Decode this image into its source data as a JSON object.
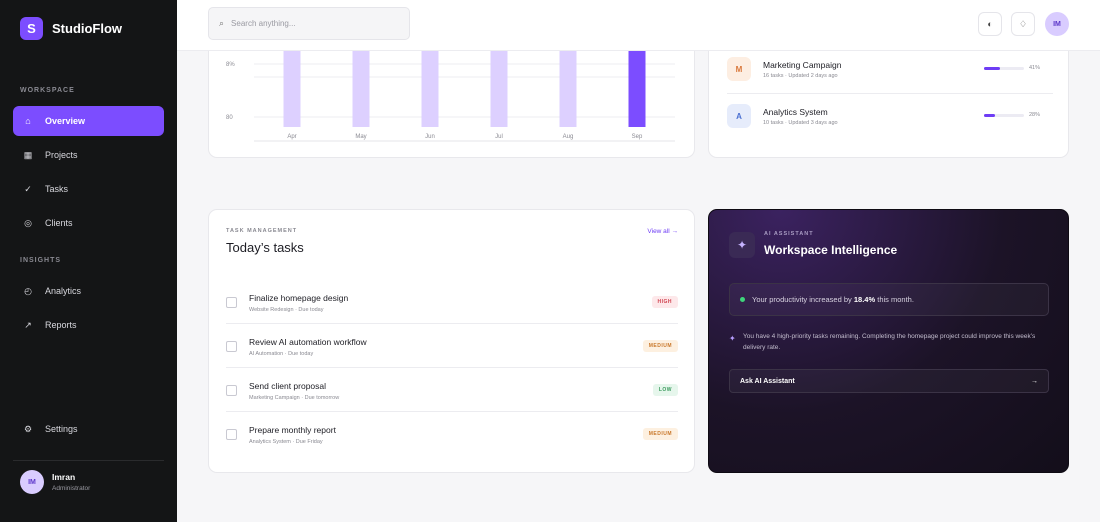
{
  "brand": {
    "logo_letter": "S",
    "name": "StudioFlow",
    "accent": "#7c4dff"
  },
  "sidebar": {
    "workspace_label": "WORKSPACE",
    "insights_label": "INSIGHTS",
    "items": [
      {
        "label": "Overview",
        "icon": "home-icon",
        "active": true
      },
      {
        "label": "Projects",
        "icon": "grid-icon"
      },
      {
        "label": "Tasks",
        "icon": "check-icon"
      },
      {
        "label": "Clients",
        "icon": "users-icon"
      },
      {
        "label": "Analytics",
        "icon": "chart-icon"
      },
      {
        "label": "Reports",
        "icon": "report-icon"
      },
      {
        "label": "Settings",
        "icon": "gear-icon"
      }
    ],
    "user": {
      "initials": "IM",
      "name": "Imran",
      "role": "Administrator"
    }
  },
  "header": {
    "search_placeholder": "Search anything...",
    "avatar_initials": "IM"
  },
  "chart_data": {
    "type": "bar",
    "categories": [
      "Apr",
      "May",
      "Jun",
      "Jul",
      "Aug",
      "Sep"
    ],
    "values": [
      78,
      78,
      78,
      78,
      78,
      78
    ],
    "highlight_index": 5,
    "y_ticks": [
      "8%",
      "80"
    ],
    "colors": {
      "bar": "#ddd0ff",
      "highlight": "#7c4dff"
    }
  },
  "projects": [
    {
      "initial": "M",
      "name": "Marketing Campaign",
      "meta": "16 tasks · Updated 2 days ago",
      "progress": 41,
      "progress_label": "41%",
      "icon_bg": "#fdeee2",
      "icon_color": "#d9773a"
    },
    {
      "initial": "A",
      "name": "Analytics System",
      "meta": "10 tasks · Updated 3 days ago",
      "progress": 28,
      "progress_label": "28%",
      "icon_bg": "#e6ecfb",
      "icon_color": "#4a6fd1"
    }
  ],
  "tasks": {
    "section_label": "TASK MANAGEMENT",
    "title": "Today’s tasks",
    "view_all": "View all →",
    "items": [
      {
        "name": "Finalize homepage design",
        "meta": "Website Redesign · Due today",
        "priority": "HIGH",
        "level": "high"
      },
      {
        "name": "Review AI automation workflow",
        "meta": "AI Automation · Due today",
        "priority": "MEDIUM",
        "level": "medium"
      },
      {
        "name": "Send client proposal",
        "meta": "Marketing Campaign · Due tomorrow",
        "priority": "LOW",
        "level": "low"
      },
      {
        "name": "Prepare monthly report",
        "meta": "Analytics System · Due Friday",
        "priority": "MEDIUM",
        "level": "medium"
      }
    ]
  },
  "ai": {
    "label": "AI ASSISTANT",
    "title": "Workspace Intelligence",
    "insight_prefix": "Your productivity increased by",
    "insight_value": "18.4%",
    "insight_suffix": "this month.",
    "note": "You have 4 high-priority tasks remaining. Completing the homepage project could improve this week’s delivery rate.",
    "button_label": "Ask AI Assistant",
    "button_arrow": "→"
  }
}
